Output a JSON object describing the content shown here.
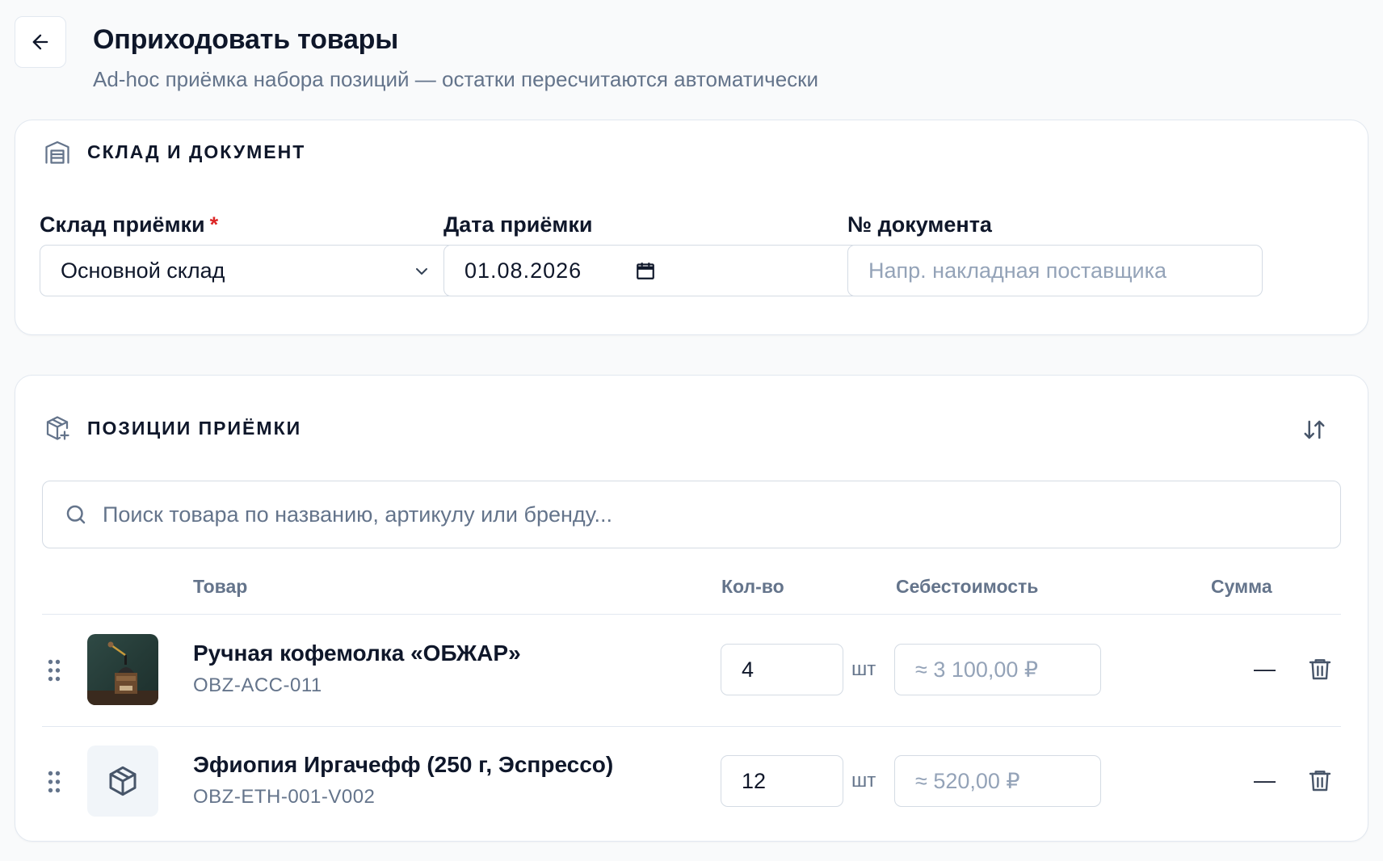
{
  "page": {
    "title": "Оприходовать товары",
    "subtitle": "Ad-hoc приёмка набора позиций — остатки пересчитаются автоматически",
    "back_icon": "arrow-left-icon"
  },
  "warehouse_section": {
    "title": "СКЛАД И ДОКУМЕНТ",
    "icon": "warehouse-icon",
    "fields": {
      "warehouse": {
        "label": "Склад приёмки",
        "required_mark": "*",
        "value": "Основной склад"
      },
      "date": {
        "label": "Дата приёмки",
        "value": "01.08.2026"
      },
      "doc_number": {
        "label": "№ документа",
        "value": "",
        "placeholder": "Напр. накладная поставщика"
      }
    }
  },
  "items_section": {
    "title": "ПОЗИЦИИ ПРИЁМКИ",
    "icon": "package-plus-icon",
    "search_placeholder": "Поиск товара по названию, артикулу или бренду...",
    "columns": {
      "product": "Товар",
      "qty": "Кол-во",
      "cost": "Себестоимость",
      "sum": "Сумма"
    },
    "rows": [
      {
        "name": "Ручная кофемолка «ОБЖАР»",
        "sku": "OBZ-ACC-011",
        "qty": "4",
        "unit": "шт",
        "cost_placeholder": "≈ 3 100,00 ₽",
        "sum": "—",
        "thumb": "photo"
      },
      {
        "name": "Эфиопия Иргачефф (250 г, Эспрессо)",
        "sku": "OBZ-ETH-001-V002",
        "qty": "12",
        "unit": "шт",
        "cost_placeholder": "≈ 520,00 ₽",
        "sum": "—",
        "thumb": "box-icon"
      }
    ]
  },
  "colors": {
    "accent_required": "#dc2626",
    "text": "#0f172a",
    "muted": "#64748b",
    "border": "#e2e8f0"
  }
}
